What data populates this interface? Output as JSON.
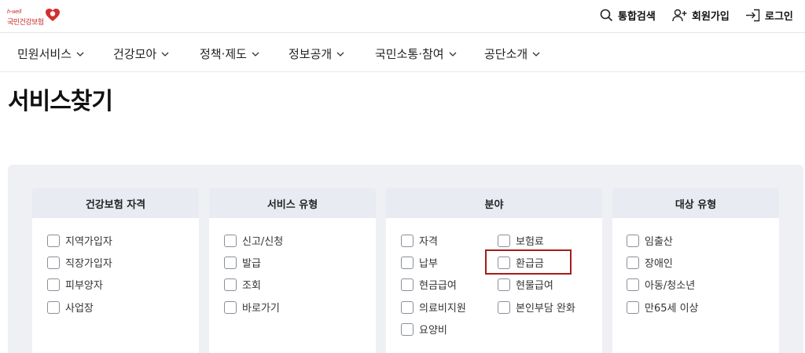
{
  "logo": {
    "tagline": "h-well",
    "name": "국민건강보험"
  },
  "utility": {
    "search": "통합검색",
    "join": "회원가입",
    "login": "로그인"
  },
  "gnb": [
    "민원서비스",
    "건강모아",
    "정책·제도",
    "정보공개",
    "국민소통·참여",
    "공단소개"
  ],
  "page_title": "서비스찾기",
  "filters": {
    "qualification": {
      "title": "건강보험 자격",
      "options": [
        "지역가입자",
        "직장가입자",
        "피부양자",
        "사업장"
      ]
    },
    "service_type": {
      "title": "서비스 유형",
      "options": [
        "신고/신청",
        "발급",
        "조회",
        "바로가기"
      ]
    },
    "field": {
      "title": "분야",
      "options": [
        "자격",
        "보험료",
        "납부",
        "환급금",
        "현금급여",
        "현물급여",
        "의료비지원",
        "본인부담 완화",
        "요양비"
      ]
    },
    "target": {
      "title": "대상 유형",
      "options": [
        "임출산",
        "장애인",
        "아동/청소년",
        "만65세 이상"
      ]
    }
  },
  "colors": {
    "brand": "#c62828",
    "highlight": "#a61b1b",
    "panel_bg": "#eef0f4",
    "header_bg": "#e8ebf2"
  }
}
